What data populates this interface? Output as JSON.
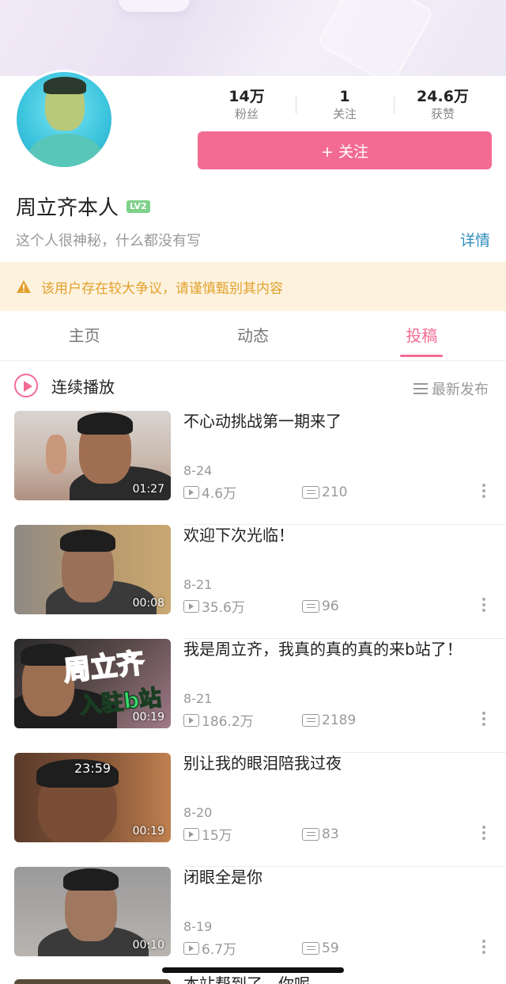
{
  "profile": {
    "name": "周立齐本人",
    "level": "LV2",
    "bio": "这个人很神秘，什么都没有写",
    "detail_label": "详情",
    "follow_label": "+ 关注",
    "stats": [
      {
        "value": "14万",
        "label": "粉丝"
      },
      {
        "value": "1",
        "label": "关注"
      },
      {
        "value": "24.6万",
        "label": "获赞"
      }
    ]
  },
  "warning": {
    "text": "该用户存在较大争议，请谨慎甄别其内容",
    "color": "#e2a12d"
  },
  "tabs": [
    {
      "label": "主页",
      "active": false
    },
    {
      "label": "动态",
      "active": false
    },
    {
      "label": "投稿",
      "active": true
    }
  ],
  "list_header": {
    "play_all_label": "连续播放",
    "sort_label": "最新发布"
  },
  "videos": [
    {
      "title": "不心动挑战第一期来了",
      "date": "8-24",
      "views": "4.6万",
      "comments": "210",
      "duration": "01:27"
    },
    {
      "title": "欢迎下次光临！",
      "date": "8-21",
      "views": "35.6万",
      "comments": "96",
      "duration": "00:08"
    },
    {
      "title": "我是周立齐，我真的真的真的来b站了！",
      "date": "8-21",
      "views": "186.2万",
      "comments": "2189",
      "duration": "00:19",
      "thumb_text": "周立齐",
      "thumb_subtext": "入驻b站"
    },
    {
      "title": "别让我的眼泪陪我过夜",
      "date": "8-20",
      "views": "15万",
      "comments": "83",
      "duration": "00:19",
      "thumb_overlay_time": "23:59"
    },
    {
      "title": "闭眼全是你",
      "date": "8-19",
      "views": "6.7万",
      "comments": "59",
      "duration": "00:10"
    }
  ],
  "partial_next_title": "本站帮到了，你呢",
  "colors": {
    "accent": "#f36b93",
    "link": "#2d8dbd",
    "warning_bg": "#fdf2de"
  },
  "icons": [
    "play-circle-icon",
    "sort-list-icon",
    "warning-icon",
    "play-count-icon",
    "danmaku-icon",
    "more-vertical-icon"
  ]
}
